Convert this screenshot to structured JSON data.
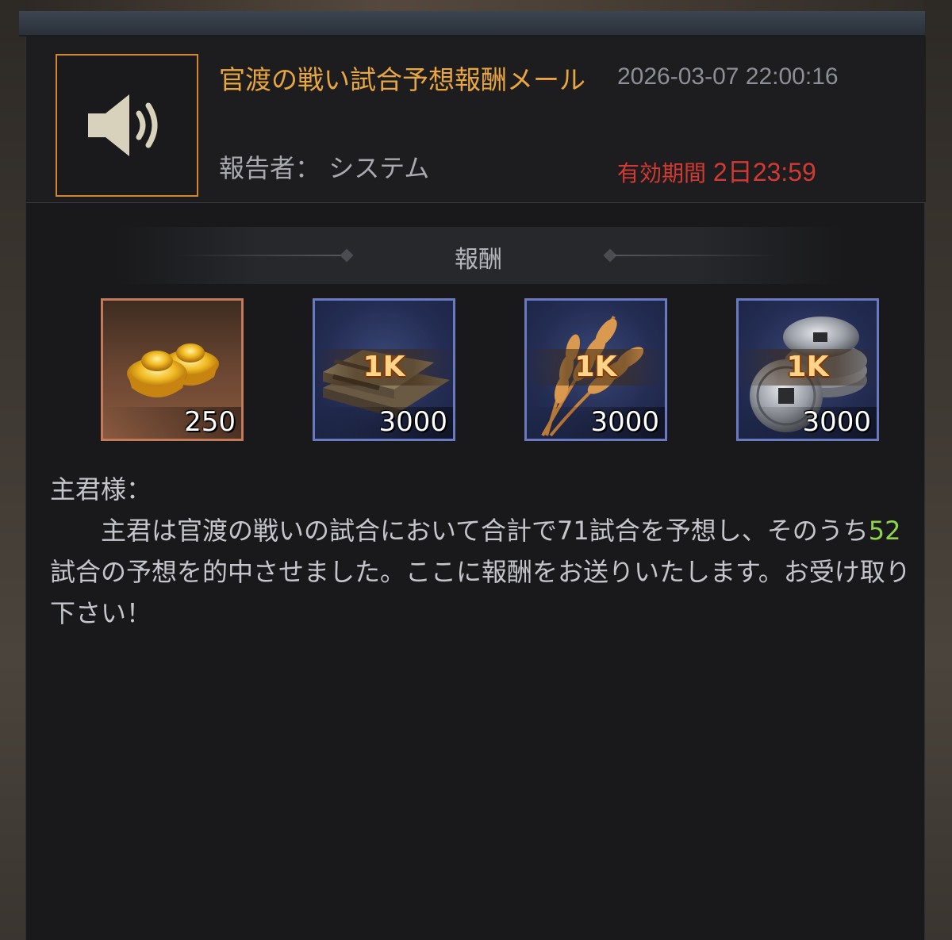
{
  "mail": {
    "title": "官渡の戦い試合予想報酬メール",
    "date": "2026-03-07 22:00:16",
    "reporter_label": "報告者：",
    "reporter_name": "システム",
    "expiry_label": "有効期間 ",
    "expiry_value": "2日23:59",
    "icon": "speaker-icon"
  },
  "rewards": {
    "heading": "報酬",
    "items": [
      {
        "icon": "gold-ingot-icon",
        "badge": "",
        "quantity": "250"
      },
      {
        "icon": "wood-planks-icon",
        "badge": "1K",
        "quantity": "3000"
      },
      {
        "icon": "wheat-icon",
        "badge": "1K",
        "quantity": "3000"
      },
      {
        "icon": "silver-coins-icon",
        "badge": "1K",
        "quantity": "3000"
      }
    ]
  },
  "body": {
    "salutation": "主君様：",
    "line_part1": "主君は官渡の戦いの試合において合計で71試合を予想し、そのうち",
    "highlight": "52",
    "line_part2": "試合の予想を的中させました。ここに報酬をお送りいたします。お受け取り下さい！"
  },
  "colors": {
    "title": "#e8a640",
    "expiry": "#d23a32",
    "highlight": "#8fd44a",
    "icon_border": "#d4862c"
  }
}
